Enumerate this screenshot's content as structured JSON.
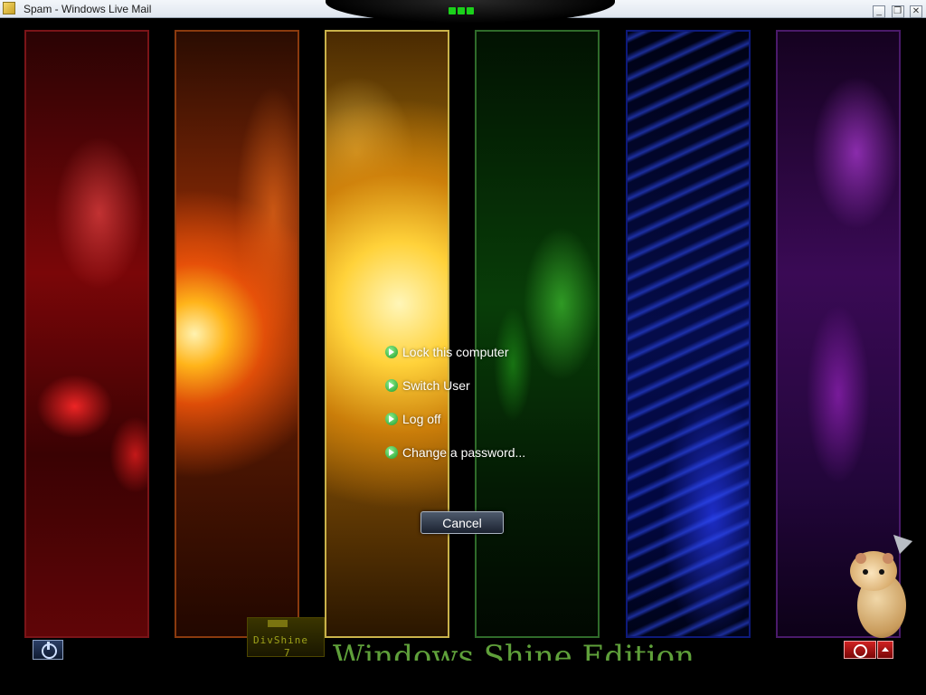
{
  "window": {
    "title": "Spam - Windows Live Mail",
    "controls": [
      "minimize",
      "restore",
      "close"
    ]
  },
  "menu": {
    "items": [
      {
        "label": "Lock this computer",
        "icon": "green-arrow-icon"
      },
      {
        "label": "Switch User",
        "icon": "green-arrow-icon"
      },
      {
        "label": "Log off",
        "icon": "green-arrow-icon"
      },
      {
        "label": "Change a password...",
        "icon": "green-arrow-icon"
      }
    ],
    "cancel_label": "Cancel"
  },
  "branding": {
    "badge_name": "DivShine",
    "badge_version": "7",
    "edition_text": "Windows Shine Edition"
  },
  "panels": [
    "red",
    "orange",
    "yellow",
    "green",
    "blue",
    "purple"
  ],
  "colors": {
    "red": "#7a0608",
    "orange": "#8a2a05",
    "yellow": "#b07a0a",
    "green": "#083d08",
    "blue": "#050c4a",
    "purple": "#3a0a55",
    "accent_green": "#1bd11b"
  },
  "icons": {
    "ease_of_access": "ease-of-access-icon",
    "power": "power-icon",
    "power_options": "power-options-arrow-icon"
  }
}
